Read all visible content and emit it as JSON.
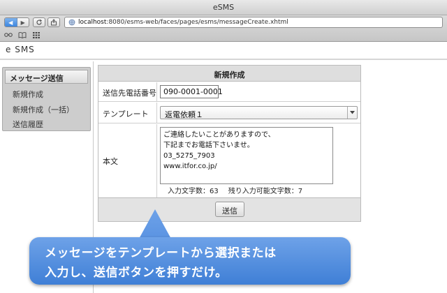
{
  "window": {
    "title": "eSMS"
  },
  "browser": {
    "url_host": "localhost",
    "url_rest": ":8080/esms-web/faces/pages/esms/messageCreate.xhtml"
  },
  "app": {
    "title": "e SMS"
  },
  "sidebar": {
    "heading": "メッセージ送信",
    "items": [
      {
        "label": "新規作成"
      },
      {
        "label": "新規作成（一括）"
      },
      {
        "label": "送信履歴"
      }
    ]
  },
  "form": {
    "heading": "新規作成",
    "phone_label": "送信先電話番号",
    "phone_value": "090-0001-0001",
    "template_label": "テンプレート",
    "template_value": "返電依頼１",
    "body_label": "本文",
    "body_lines": [
      "ご連絡したいことがありますので、",
      "下記までお電話下さいませ。",
      "03_5275_7903",
      "www.itfor.co.jp/"
    ],
    "input_count_text": "入力文字数：63",
    "remaining_count_text": "残り入力可能文字数：7",
    "submit_label": "送信"
  },
  "callout": {
    "line1": "メッセージをテンプレートから選択または",
    "line2": "入力し、送信ボタンを押すだけ。"
  }
}
